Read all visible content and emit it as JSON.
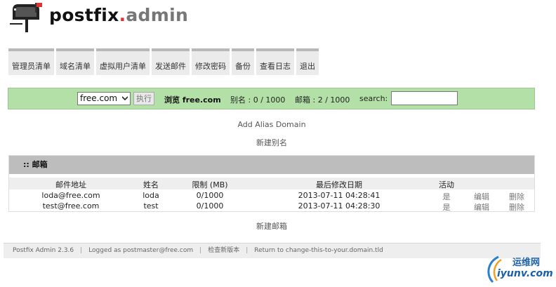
{
  "logo": {
    "part1": "postfix",
    "dot": ".",
    "part2": "admin"
  },
  "nav": [
    "管理员清单",
    "域名清单",
    "虚拟用户清单",
    "发送邮件",
    "修改密码",
    "备份",
    "查看日志",
    "退出"
  ],
  "domain_bar": {
    "selected_domain": "free.com",
    "exec_button": "执行",
    "browse_text": "浏览 free.com",
    "alias_stat": "别名 : 0 / 1000",
    "mailbox_stat": "邮箱 : 2 / 1000",
    "search_label": "search:",
    "search_value": ""
  },
  "links": {
    "add_alias_domain": "Add Alias Domain",
    "new_alias": "新建别名",
    "new_mailbox": "新建邮箱"
  },
  "mailbox_table": {
    "title": ":: 邮箱",
    "headers": {
      "address": "邮件地址",
      "name": "姓名",
      "quota": "限制 (MB)",
      "modified": "最后修改日期",
      "active": "活动"
    },
    "rows": [
      {
        "address": "loda@free.com",
        "name": "loda",
        "quota": "0/1000",
        "modified": "2013-07-11 04:28:41",
        "active": "是",
        "edit": "编辑",
        "delete": "删除"
      },
      {
        "address": "test@free.com",
        "name": "test",
        "quota": "0/1000",
        "modified": "2013-07-11 04:28:30",
        "active": "是",
        "edit": "编辑",
        "delete": "删除"
      }
    ]
  },
  "footer": {
    "version": "Postfix Admin 2.3.6",
    "logged_as": "Logged as postmaster@free.com",
    "check_version": "检查新版本",
    "return_link": "Return to change-this-to-your.domain.tld"
  },
  "watermark": {
    "line1": "运维网",
    "line2": "iyunv.com"
  },
  "colors": {
    "bar_green": "#b2e0a6",
    "table_header": "#bdbdbd",
    "logo_dot": "#dd3333",
    "watermark_blue": "#1b5fa8"
  },
  "icons": {
    "logo": "mailbox-icon",
    "select_caret": "chevron-down-icon",
    "watermark": "swoosh-logo-icon"
  }
}
